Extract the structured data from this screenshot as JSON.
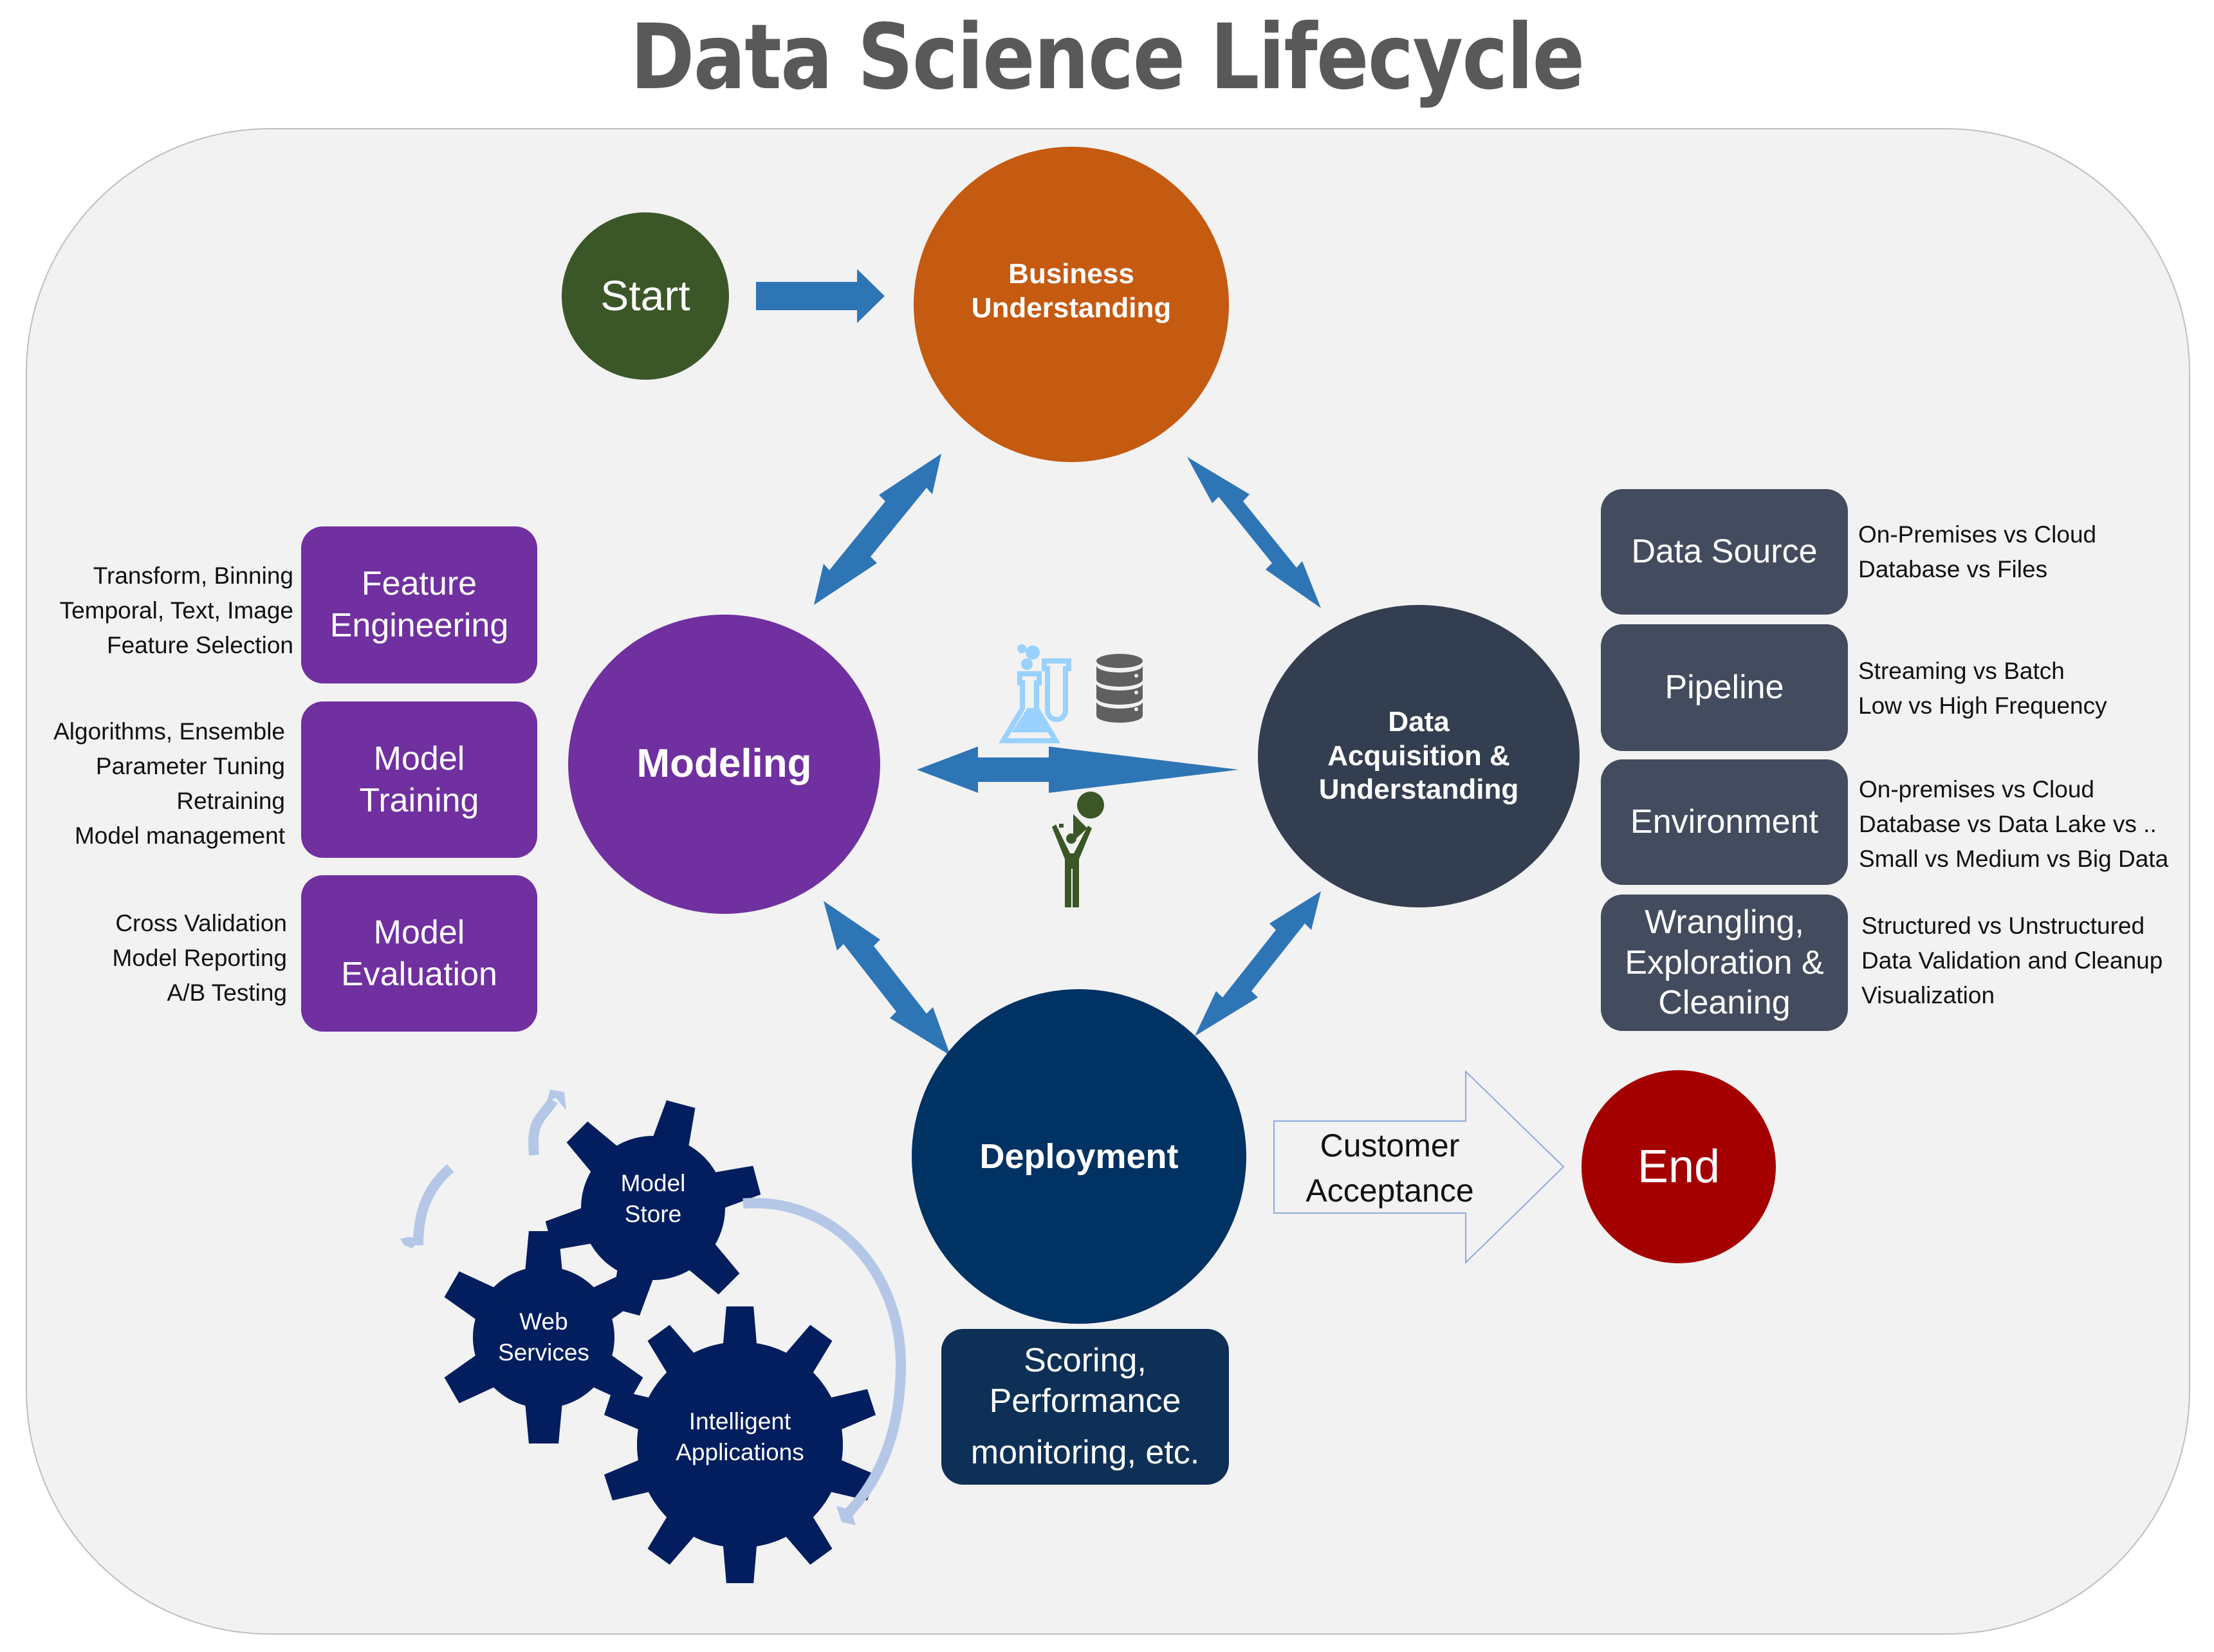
{
  "title": "Data Science Lifecycle",
  "colors": {
    "start": "#3b5727",
    "business": "#c55a11",
    "modeling": "#7030a0",
    "acquisition": "#333f50",
    "deployment": "#003264",
    "end": "#a50000",
    "arrow": "#2e75b6",
    "gear": "#021e5e",
    "gear_arrow": "#b4c7e7",
    "panel": "#f2f2f2"
  },
  "nodes": {
    "start": "Start",
    "business": [
      "Business",
      "Understanding"
    ],
    "modeling": "Modeling",
    "acquisition": [
      "Data",
      "Acquisition &",
      "Understanding"
    ],
    "deployment": "Deployment",
    "end": "End"
  },
  "modeling_steps": [
    {
      "label": [
        "Feature",
        "Engineering"
      ],
      "notes": [
        "Transform, Binning",
        "Temporal, Text, Image",
        "Feature Selection"
      ]
    },
    {
      "label": [
        "Model",
        "Training"
      ],
      "notes": [
        "Algorithms, Ensemble",
        "Parameter Tuning",
        "Retraining",
        "Model management"
      ]
    },
    {
      "label": [
        "Model",
        "Evaluation"
      ],
      "notes": [
        "Cross Validation",
        "Model Reporting",
        "A/B Testing"
      ]
    }
  ],
  "acquisition_steps": [
    {
      "label": [
        "Data Source"
      ],
      "notes": [
        "On-Premises vs Cloud",
        "Database vs Files"
      ]
    },
    {
      "label": [
        "Pipeline"
      ],
      "notes": [
        "Streaming vs Batch",
        "Low vs High Frequency"
      ]
    },
    {
      "label": [
        "Environment"
      ],
      "notes": [
        "On-premises vs Cloud",
        "Database vs Data Lake  vs ..",
        "Small vs Medium vs Big Data"
      ]
    },
    {
      "label": [
        "Wrangling,",
        "Exploration &",
        "Cleaning"
      ],
      "notes": [
        "Structured vs Unstructured",
        "Data Validation and Cleanup",
        "Visualization"
      ]
    }
  ],
  "deployment_box": [
    "Scoring,",
    "Performance",
    "monitoring, etc."
  ],
  "customer_acceptance": [
    "Customer",
    "Acceptance"
  ],
  "gears": {
    "model_store": [
      "Model",
      "Store"
    ],
    "web_services": [
      "Web",
      "Services"
    ],
    "intelligent_apps": [
      "Intelligent",
      "Applications"
    ]
  },
  "icons": {
    "lab": "lab-flask-icon",
    "database": "database-icon",
    "idea": "person-lightbulb-icon"
  }
}
